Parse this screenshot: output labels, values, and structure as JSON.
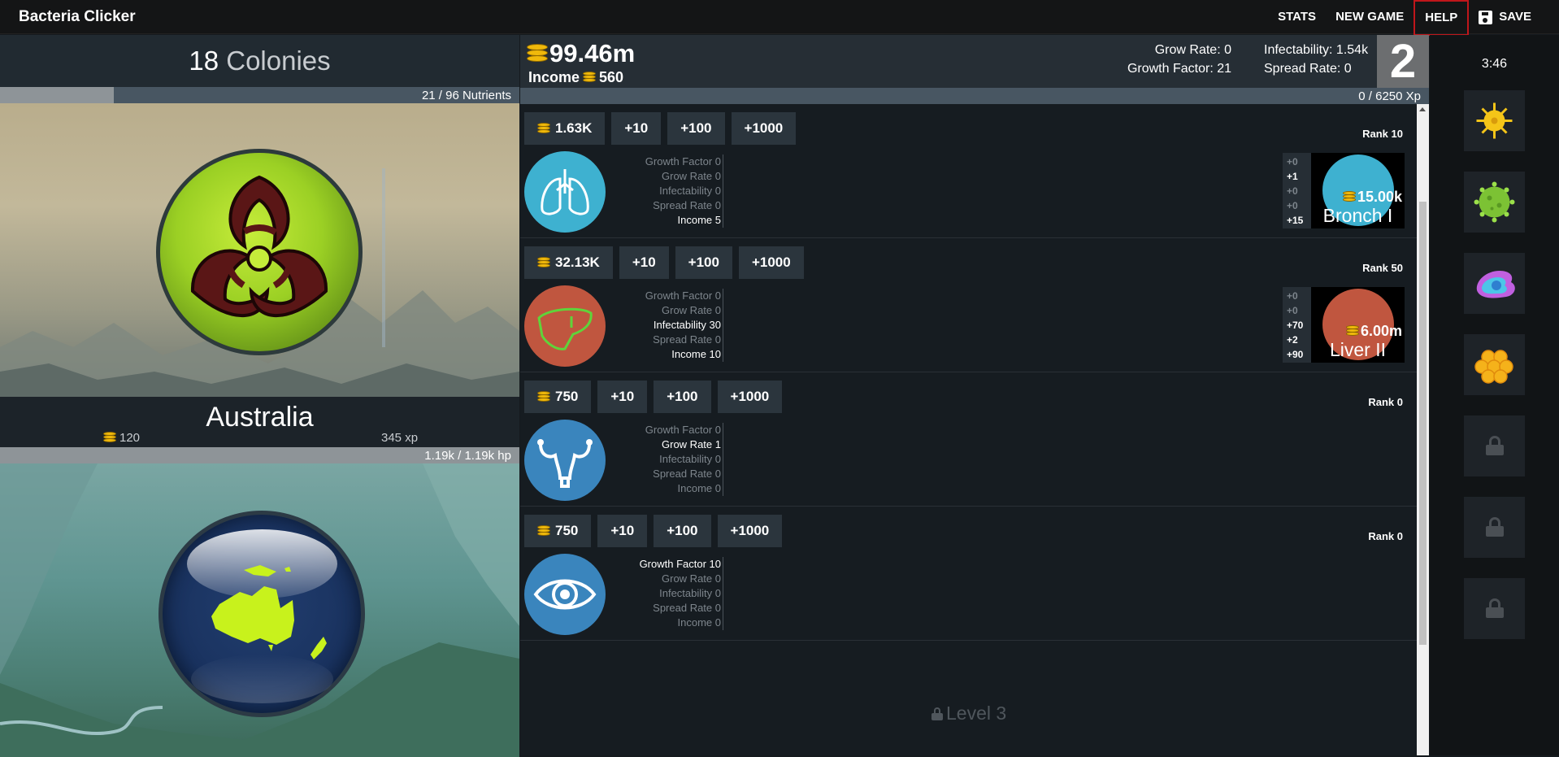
{
  "app": {
    "title": "Bacteria Clicker"
  },
  "nav": {
    "stats": "STATS",
    "new_game": "NEW GAME",
    "help": "HELP",
    "save": "SAVE"
  },
  "left": {
    "colonies_count": "18",
    "colonies_label": "Colonies",
    "nutrients": {
      "label": "21 / 96 Nutrients",
      "current": 21,
      "max": 96
    },
    "region": {
      "name": "Australia",
      "coins": "120",
      "xp": "345 xp"
    },
    "hp": {
      "label": "1.19k / 1.19k hp",
      "fraction": 1.0
    }
  },
  "top": {
    "money": "99.46m",
    "income_label": "Income",
    "income_value": "560",
    "grow_rate": "Grow Rate: 0",
    "infectability": "Infectability: 1.54k",
    "growth_factor": "Growth Factor: 21",
    "spread_rate": "Spread Rate: 0",
    "level": "2",
    "xp": {
      "label": "0 / 6250 Xp",
      "current": 0,
      "max": 6250
    }
  },
  "organs": [
    {
      "icon": "lungs-icon",
      "color": "#3eb1d0",
      "cost": "1.63K",
      "buy": [
        "+10",
        "+100",
        "+1000"
      ],
      "rank": "Rank 10",
      "stats": [
        "Growth Factor 0",
        "Grow Rate 0",
        "Infectability 0",
        "Spread Rate 0",
        "Income 5"
      ],
      "highlight": [
        4
      ],
      "upgrade": {
        "deltas": [
          "+0",
          "+1",
          "+0",
          "+0",
          "+15"
        ],
        "deltas_hi": [
          1,
          4
        ],
        "price": "15.00k",
        "name": "Bronch I",
        "color": "#3eb1d0"
      }
    },
    {
      "icon": "liver-icon",
      "color": "#c0563f",
      "cost": "32.13K",
      "buy": [
        "+10",
        "+100",
        "+1000"
      ],
      "rank": "Rank 50",
      "stats": [
        "Growth Factor 0",
        "Grow Rate 0",
        "Infectability 30",
        "Spread Rate 0",
        "Income 10"
      ],
      "highlight": [
        2,
        4
      ],
      "upgrade": {
        "deltas": [
          "+0",
          "+0",
          "+70",
          "+2",
          "+90"
        ],
        "deltas_hi": [
          2,
          3,
          4
        ],
        "price": "6.00m",
        "name": "Liver II",
        "color": "#c0563f"
      }
    },
    {
      "icon": "uterus-icon",
      "color": "#3a85bd",
      "cost": "750",
      "buy": [
        "+10",
        "+100",
        "+1000"
      ],
      "rank": "Rank 0",
      "stats": [
        "Growth Factor 0",
        "Grow Rate 1",
        "Infectability 0",
        "Spread Rate 0",
        "Income 0"
      ],
      "highlight": [
        1
      ]
    },
    {
      "icon": "eye-icon",
      "color": "#3a85bd",
      "cost": "750",
      "buy": [
        "+10",
        "+100",
        "+1000"
      ],
      "rank": "Rank 0",
      "stats": [
        "Growth Factor 10",
        "Grow Rate 0",
        "Infectability 0",
        "Spread Rate 0",
        "Income 0"
      ],
      "highlight": [
        0
      ]
    }
  ],
  "locked_level": "Level 3",
  "right": {
    "timer": "3:46",
    "bacteria": [
      "yellow-virus-icon",
      "green-virus-icon",
      "purple-amoeba-icon",
      "orange-cluster-icon",
      "lock-icon",
      "lock-icon",
      "lock-icon"
    ]
  }
}
